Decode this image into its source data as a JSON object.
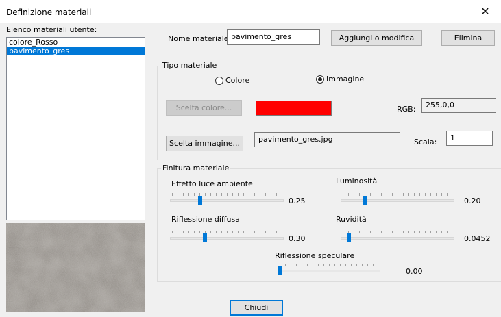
{
  "window": {
    "title": "Definizione materiali"
  },
  "list": {
    "label": "Elenco materiali utente:",
    "items": [
      {
        "label": "colore_Rosso",
        "selected": false
      },
      {
        "label": "pavimento_gres",
        "selected": true
      }
    ]
  },
  "name": {
    "label": "Nome materiale:",
    "value": "pavimento_gres",
    "add_button": "Aggiungi o modifica",
    "delete_button": "Elimina"
  },
  "type": {
    "group_title": "Tipo materiale",
    "radio_color": "Colore",
    "radio_image": "Immagine",
    "selected": "Immagine",
    "color_button": "Scelta colore...",
    "color_value": "#ff0000",
    "rgb_label": "RGB:",
    "rgb_value": "255,0,0",
    "image_button": "Scelta immagine...",
    "image_file": "pavimento_gres.jpg",
    "scale_label": "Scala:",
    "scale_value": "1"
  },
  "finish": {
    "group_title": "Finitura materiale",
    "ambient": {
      "label": "Effetto luce ambiente",
      "value": "0.25",
      "fraction": 0.25
    },
    "brightness": {
      "label": "Luminosità",
      "value": "0.20",
      "fraction": 0.2
    },
    "diffuse": {
      "label": "Riflessione diffusa",
      "value": "0.30",
      "fraction": 0.3
    },
    "roughness": {
      "label": "Ruvidità",
      "value": "0.0452",
      "fraction": 0.05
    },
    "specular": {
      "label": "Riflessione speculare",
      "value": "0.00",
      "fraction": 0.0
    }
  },
  "footer": {
    "close_button": "Chiudi"
  },
  "colors": {
    "accent": "#0078d7",
    "swatch": "#ff0000"
  }
}
